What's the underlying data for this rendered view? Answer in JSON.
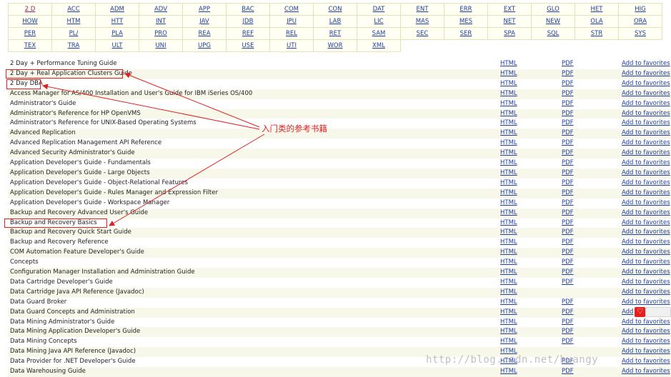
{
  "index_grid": {
    "rows": [
      [
        "2 D",
        "ACC",
        "ADM",
        "ADV",
        "APP",
        "BAC",
        "COM",
        "CON",
        "DAT",
        "ENT",
        "ERR",
        "EXT",
        "GLO",
        "HET",
        "HIG"
      ],
      [
        "HOW",
        "HTM",
        "HTT",
        "INT",
        "JAV",
        "JDB",
        "JPU",
        "LAB",
        "LIC",
        "MAS",
        "MES",
        "NET",
        "NEW",
        "OLA",
        "ORA"
      ],
      [
        "PER",
        "PL/",
        "PLA",
        "PRO",
        "REA",
        "REF",
        "REL",
        "RET",
        "SAM",
        "SEC",
        "SER",
        "SPA",
        "SQL",
        "STR",
        "SYS"
      ],
      [
        "TEX",
        "TRA",
        "ULT",
        "UNI",
        "UPG",
        "USE",
        "UTI",
        "WOR",
        "XML"
      ]
    ],
    "visited_color": "#a31b5c",
    "link_color": "#1f3f9f"
  },
  "books": {
    "html_label": "HTML",
    "pdf_label": "PDF",
    "fav_label": "Add to favorites",
    "fav_label_short": "Add",
    "items": [
      {
        "title": "2 Day + Performance Tuning Guide",
        "pdf": true
      },
      {
        "title": "2 Day + Real Application Clusters Guide",
        "pdf": true
      },
      {
        "title": "2 Day DBA",
        "pdf": true
      },
      {
        "title": "Access Manager for AS/400 Installation and User's Guide for IBM iSeries OS/400",
        "pdf": true
      },
      {
        "title": "Administrator's Guide",
        "pdf": true
      },
      {
        "title": "Administrator's Reference for HP OpenVMS",
        "pdf": true
      },
      {
        "title": "Administrator's Reference for UNIX-Based Operating Systems",
        "pdf": true
      },
      {
        "title": "Advanced Replication",
        "pdf": true
      },
      {
        "title": "Advanced Replication Management API Reference",
        "pdf": true
      },
      {
        "title": "Advanced Security Administrator's Guide",
        "pdf": true
      },
      {
        "title": "Application Developer's Guide - Fundamentals",
        "pdf": true
      },
      {
        "title": "Application Developer's Guide - Large Objects",
        "pdf": true
      },
      {
        "title": "Application Developer's Guide - Object-Relational Features",
        "pdf": true
      },
      {
        "title": "Application Developer's Guide - Rules Manager and Expression Filter",
        "pdf": true
      },
      {
        "title": "Application Developer's Guide - Workspace Manager",
        "pdf": true
      },
      {
        "title": "Backup and Recovery Advanced User's Guide",
        "pdf": true
      },
      {
        "title": "Backup and Recovery Basics",
        "pdf": true
      },
      {
        "title": "Backup and Recovery Quick Start Guide",
        "pdf": true
      },
      {
        "title": "Backup and Recovery Reference",
        "pdf": true
      },
      {
        "title": "COM Automation Feature Developer's Guide",
        "pdf": true
      },
      {
        "title": "Concepts",
        "pdf": true
      },
      {
        "title": "Configuration Manager Installation and Administration Guide",
        "pdf": true
      },
      {
        "title": "Data Cartridge Developer's Guide",
        "pdf": true
      },
      {
        "title": "Data Cartridge Java API Reference (Javadoc)",
        "pdf": false
      },
      {
        "title": "Data Guard Broker",
        "pdf": true
      },
      {
        "title": "Data Guard Concepts and Administration",
        "pdf": true,
        "fav_short": true
      },
      {
        "title": "Data Mining Administrator's Guide",
        "pdf": true
      },
      {
        "title": "Data Mining Application Developer's Guide",
        "pdf": true
      },
      {
        "title": "Data Mining Concepts",
        "pdf": true
      },
      {
        "title": "Data Mining Java API Reference (Javadoc)",
        "pdf": false
      },
      {
        "title": "Data Provider for .NET Developer's Guide",
        "pdf": true
      },
      {
        "title": "Data Warehousing Guide",
        "pdf": true
      }
    ]
  },
  "annotation": {
    "note": "入门类的参考书籍",
    "color": "#e02020"
  },
  "watermark": "http://blog.csdn.net/huangy",
  "popup_icon": "heart-icon"
}
